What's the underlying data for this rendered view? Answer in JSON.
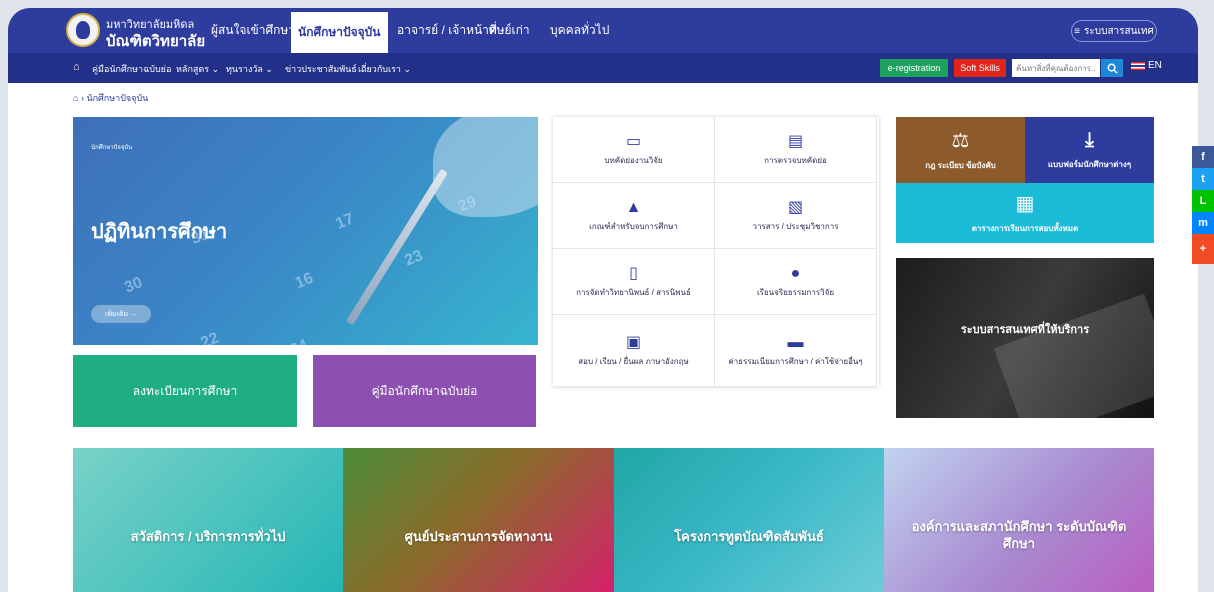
{
  "header": {
    "brand_line1": "มหาวิทยาลัยมหิดล",
    "brand_line2": "บัณฑิตวิทยาลัย",
    "nav": [
      {
        "label": "ผู้สนใจเข้าศึกษา"
      },
      {
        "label": "นักศึกษาปัจจุบัน"
      },
      {
        "label": "อาจารย์ / เจ้าหน้าที่"
      },
      {
        "label": "ศิษย์เก่า"
      },
      {
        "label": "บุคคลทั่วไป"
      }
    ],
    "library_button": "ระบบสารสนเทศ"
  },
  "subnav": {
    "items": [
      {
        "label": "คู่มือนักศึกษาฉบับย่อ"
      },
      {
        "label": "หลักสูตร ⌄"
      },
      {
        "label": "ทุนรางวัล ⌄"
      },
      {
        "label": "ข่าวประชาสัมพันธ์ ⌄"
      },
      {
        "label": "เกี่ยวกับเรา ⌄"
      }
    ],
    "ereg": "e-registration",
    "soft_skills": "Soft Skills",
    "search_placeholder": "ค้นหาสิ่งที่คุณต้องการ...",
    "lang": "EN"
  },
  "breadcrumb": {
    "home_icon": "home-icon",
    "current": "นักศึกษาปัจจุบัน"
  },
  "hero": {
    "small": "นักศึกษาปัจจุบัน",
    "title": "ปฏิทินการศึกษา",
    "button": "เพิ่มเติม →",
    "calendar_numbers": [
      "30",
      "31",
      "16",
      "17",
      "23",
      "24",
      "29",
      "22"
    ]
  },
  "tiles": {
    "register": "ลงทะเบียนการศึกษา",
    "handbook": "คู่มือนักศึกษาฉบับย่อ"
  },
  "grid": [
    {
      "label": "บทคัดย่องานวิจัย",
      "icon": "certificate-icon"
    },
    {
      "label": "การตรวจบทคัดย่อ",
      "icon": "document-check-icon"
    },
    {
      "label": "เกณฑ์สำหรับจบการศึกษา",
      "icon": "graduation-icon"
    },
    {
      "label": "วารสาร / ประชุมวิชาการ",
      "icon": "journal-icon"
    },
    {
      "label": "การจัดทำวิทยานิพนธ์ / สารนิพนธ์",
      "icon": "book-icon"
    },
    {
      "label": "เรียนจริยธรรมการวิจัย",
      "icon": "user-icon"
    },
    {
      "label": "สอบ / เรียน / ยื่นผล ภาษาอังกฤษ",
      "icon": "language-icon"
    },
    {
      "label": "ค่าธรรมเนียมการศึกษา / ค่าใช้จ่ายอื่นๆ",
      "icon": "money-icon"
    }
  ],
  "right": {
    "rules": "กฎ ระเบียบ ข้อบังคับ",
    "forms": "แบบฟอร์มนักศึกษาต่างๆ",
    "schedule": "ตารางการเรียนการสอบทั้งหมด",
    "library": "ระบบสารสนเทศที่ให้บริการ"
  },
  "social": [
    "f",
    "t",
    "L",
    "m",
    "+"
  ],
  "banners": [
    {
      "title": "สวัสดิการ / บริการการทั่วไป"
    },
    {
      "title": "ศูนย์ประสานการจัดหางาน"
    },
    {
      "title": "โครงการทูตบัณฑิตสัมพันธ์"
    },
    {
      "title": "องค์การและสภานักศึกษา ระดับบัณฑิตศึกษา"
    }
  ],
  "colors": {
    "primary": "#2e3c9e",
    "green": "#1fae82",
    "purple": "#8d4fb0",
    "brown": "#8d5a2b",
    "cyan": "#1bbcd8"
  }
}
